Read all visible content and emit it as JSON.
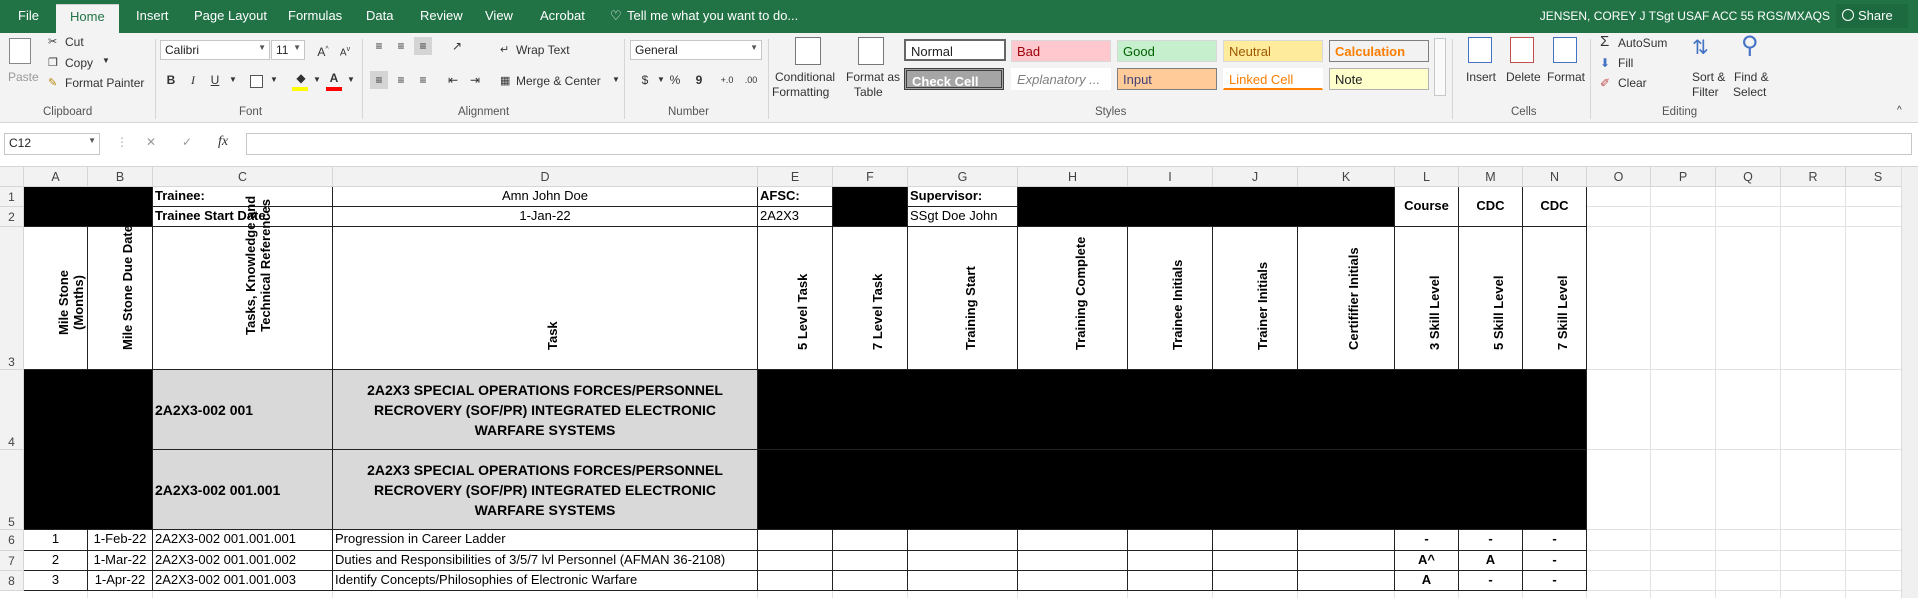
{
  "tabs": {
    "file": "File",
    "home": "Home",
    "insert": "Insert",
    "page_layout": "Page Layout",
    "formulas": "Formulas",
    "data": "Data",
    "review": "Review",
    "view": "View",
    "acrobat": "Acrobat",
    "tell_me": "Tell me what you want to do..."
  },
  "account": {
    "name": "JENSEN, COREY J TSgt USAF ACC 55 RGS/MXAQS",
    "share": "Share"
  },
  "clipboard": {
    "paste": "Paste",
    "cut": "Cut",
    "copy": "Copy",
    "format_painter": "Format Painter",
    "label": "Clipboard"
  },
  "font": {
    "name": "Calibri",
    "size": "11",
    "bold": "B",
    "italic": "I",
    "underline": "U",
    "label": "Font"
  },
  "alignment": {
    "wrap_text": "Wrap Text",
    "merge_center": "Merge & Center",
    "label": "Alignment"
  },
  "number": {
    "format": "General",
    "currency": "$",
    "percent": "%",
    "comma": "9",
    "label": "Number"
  },
  "styles": {
    "conditional": "Conditional",
    "formatting": "Formatting",
    "format_as": "Format as",
    "table": "Table",
    "normal": "Normal",
    "bad": "Bad",
    "good": "Good",
    "neutral": "Neutral",
    "calculation": "Calculation",
    "check_cell": "Check Cell",
    "explanatory": "Explanatory ...",
    "input": "Input",
    "linked_cell": "Linked Cell",
    "note": "Note",
    "label": "Styles"
  },
  "cells": {
    "insert": "Insert",
    "delete": "Delete",
    "format": "Format",
    "label": "Cells"
  },
  "editing": {
    "autosum": "AutoSum",
    "fill": "Fill",
    "clear": "Clear",
    "sort_filter": "Sort &",
    "filter": "Filter",
    "find_select": "Find &",
    "select": "Select",
    "label": "Editing"
  },
  "formula_bar": {
    "name_box": "C12",
    "cancel": "✕",
    "enter": "✓",
    "fx": "fx",
    "content": ""
  },
  "columns": [
    "A",
    "B",
    "C",
    "D",
    "E",
    "F",
    "G",
    "H",
    "I",
    "J",
    "K",
    "L",
    "M",
    "N",
    "O",
    "P",
    "Q",
    "R",
    "S"
  ],
  "rows": [
    "1",
    "2",
    "3",
    "4",
    "5",
    "6",
    "7",
    "8"
  ],
  "header": {
    "trainee_label": "Trainee:",
    "trainee_name": "Amn John Doe",
    "afsc_label": "AFSC:",
    "supervisor_label": "Supervisor:",
    "start_label": "Trainee Start Date:",
    "start_date": "1-Jan-22",
    "afsc_value": "2A2X3",
    "supervisor_name": "SSgt Doe John",
    "course": "Course",
    "cdc_m": "CDC",
    "cdc_n": "CDC"
  },
  "col_headers": {
    "a": "Mile Stone\n(Months)",
    "b": "Mile Stone Due Date",
    "c": "Tasks, Knowledge and\nTechnical References",
    "d": "Task",
    "e": "5 Level Task",
    "f": "7 Level Task",
    "g": "Training Start",
    "h": "Training Complete",
    "i": "Trainee Initials",
    "j": "Trainer Initials",
    "k": "Certififier Initials",
    "l": "3 Skill Level",
    "m": "5 Skill Level",
    "n": "7 Skill Level"
  },
  "sections": [
    {
      "code": "2A2X3-002 001",
      "title": "2A2X3 SPECIAL OPERATIONS FORCES/PERSONNEL RECROVERY (SOF/PR) INTEGRATED ELECTRONIC WARFARE SYSTEMS"
    },
    {
      "code": "2A2X3-002 001.001",
      "title": "2A2X3 SPECIAL OPERATIONS FORCES/PERSONNEL RECROVERY (SOF/PR) INTEGRATED ELECTRONIC WARFARE SYSTEMS"
    }
  ],
  "task_rows": [
    {
      "milestone": "1",
      "due": "1-Feb-22",
      "ref": "2A2X3-002 001.001.001",
      "task": "Progression in Career Ladder",
      "l": "-",
      "m": "-",
      "n": "-"
    },
    {
      "milestone": "2",
      "due": "1-Mar-22",
      "ref": "2A2X3-002 001.001.002",
      "task": "Duties and Responsibilities of 3/5/7 lvl Personnel (AFMAN 36-2108)",
      "l": "A^",
      "m": "A",
      "n": "-"
    },
    {
      "milestone": "3",
      "due": "1-Apr-22",
      "ref": "2A2X3-002 001.001.003",
      "task": "Identify Concepts/Philosophies of Electronic Warfare",
      "l": "A",
      "m": "-",
      "n": "-"
    }
  ],
  "colors": {
    "excel_green": "#217346",
    "header_gray": "#d9d9d9",
    "black": "#000000"
  }
}
